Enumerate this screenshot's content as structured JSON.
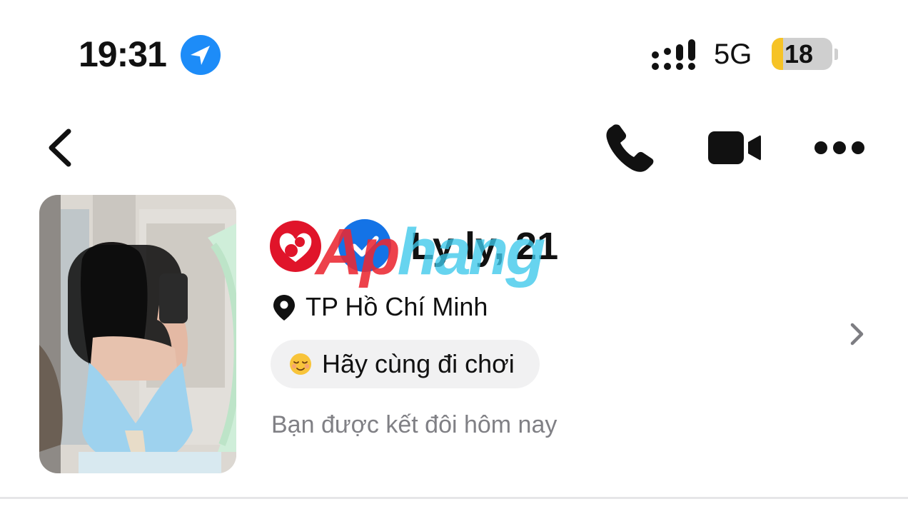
{
  "status_bar": {
    "time": "19:31",
    "network": "5G",
    "battery_level": "18",
    "icons": [
      "location-arrow-icon",
      "cellular-signal-icon",
      "battery-icon"
    ]
  },
  "nav": {
    "icons": [
      "back-chevron-icon",
      "phone-call-icon",
      "video-camera-icon",
      "more-dots-icon"
    ]
  },
  "profile": {
    "name_age": "Ly ly, 21",
    "location": "TP Hồ Chí Minh",
    "intent": "Hãy cùng đi chơi",
    "intent_emoji": "relieved-face-emoji",
    "matched_note": "Bạn được kết đôi hôm nay",
    "badges": [
      "match-heart-icon",
      "verified-badge-icon"
    ]
  },
  "watermark": {
    "part1": "Ap",
    "part2": "hang"
  },
  "colors": {
    "accent_blue": "#1d8cf8",
    "match_red": "#e0142a",
    "verified_blue": "#1473e6",
    "chip_bg": "#f1f1f2",
    "muted_text": "#808085",
    "battery_yellow": "#f6c326"
  }
}
